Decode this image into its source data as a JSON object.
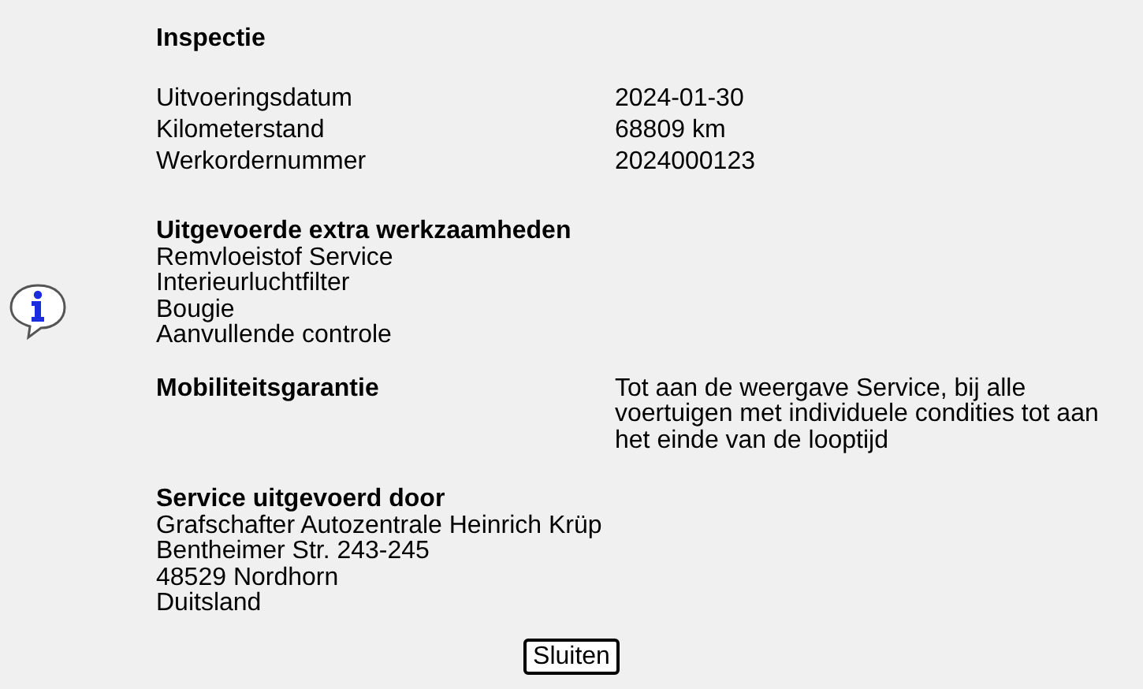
{
  "title": "Inspectie",
  "details": [
    {
      "label": "Uitvoeringsdatum",
      "value": "2024-01-30"
    },
    {
      "label": "Kilometerstand",
      "value": "68809 km"
    },
    {
      "label": "Werkordernummer",
      "value": "2024000123"
    }
  ],
  "extra_work": {
    "heading": "Uitgevoerde extra werkzaamheden",
    "items": [
      "Remvloeistof Service",
      "Interieurluchtfilter",
      "Bougie",
      "Aanvullende controle"
    ]
  },
  "mobility": {
    "label": "Mobiliteitsgarantie",
    "text": "Tot aan de weergave Service, bij alle voertuigen met individuele condities tot aan het einde van de looptijd"
  },
  "service_by": {
    "heading": "Service uitgevoerd door",
    "lines": [
      "Grafschafter Autozentrale Heinrich Krüp",
      "Bentheimer Str. 243-245",
      "48529 Nordhorn",
      "Duitsland"
    ]
  },
  "close_button": "Sluiten"
}
